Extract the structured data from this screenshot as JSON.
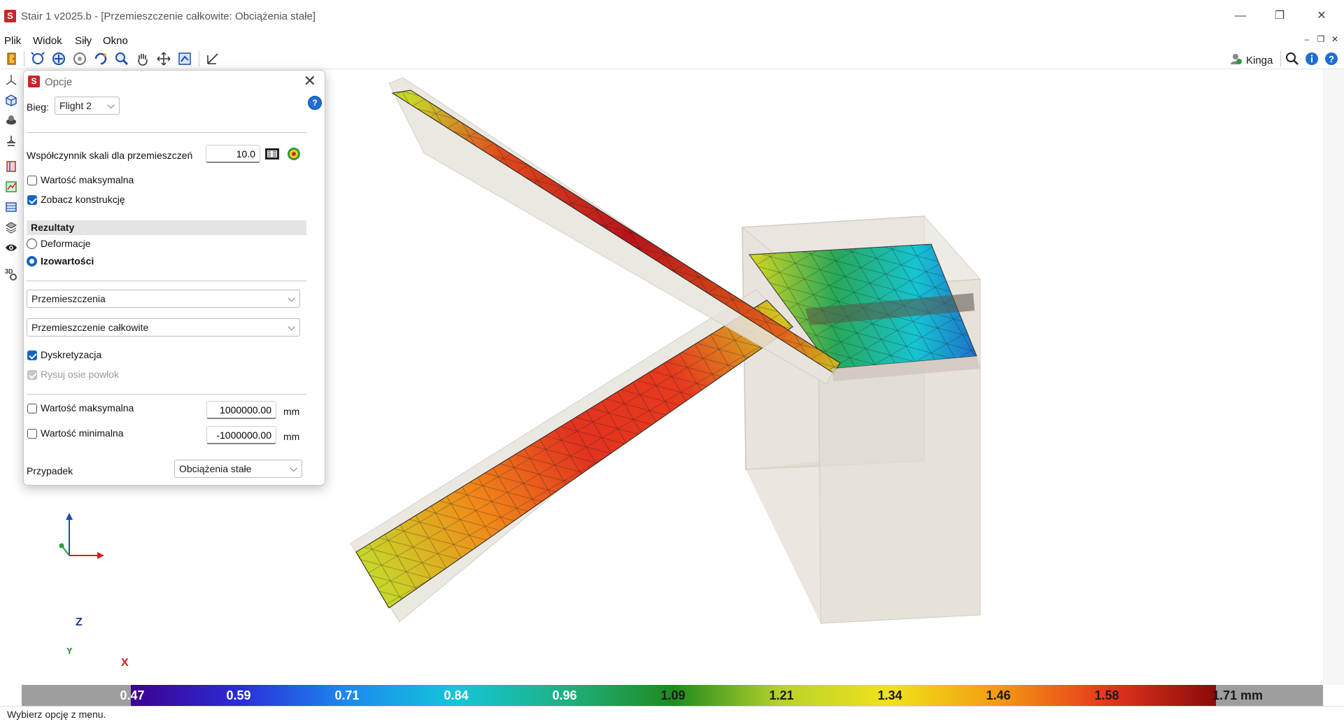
{
  "window": {
    "title": "Stair 1 v2025.b - [Przemieszczenie całkowite: Obciążenia stałe]",
    "app_icon_letter": "S",
    "minimize": "—",
    "restore": "❐",
    "close": "✕"
  },
  "menu": {
    "items": [
      "Plik",
      "Widok",
      "Siły",
      "Okno"
    ]
  },
  "mdi": {
    "minimize": "–",
    "restore": "❐",
    "close": "✕"
  },
  "toolbar": {
    "user_name": "Kinga"
  },
  "panel": {
    "title": "Opcje",
    "icon_letter": "S",
    "close": "✕",
    "help": "?",
    "flight_label": "Bieg:",
    "flight_value": "Flight 2",
    "scale_label": "Współczynnik skali dla przemieszczeń",
    "scale_value": "10.0",
    "max_value_label": "Wartość maksymalna",
    "max_value_checked": false,
    "show_structure_label": "Zobacz konstrukcję",
    "show_structure_checked": true,
    "results_header": "Rezultaty",
    "radio_deformation": "Deformacje",
    "radio_isovalues": "Izowartości",
    "selected_result": "Izowartości",
    "dropdown_quantity": "Przemieszczenia",
    "dropdown_component": "Przemieszczenie całkowite",
    "discretization_label": "Dyskretyzacja",
    "discretization_checked": true,
    "shell_axes_label": "Rysuj osie powłok",
    "shell_axes_checked": true,
    "limit_max_label": "Wartość maksymalna",
    "limit_max_value": "1000000.00",
    "limit_min_label": "Wartość minimalna",
    "limit_min_value": "-1000000.00",
    "unit": "mm",
    "case_label": "Przypadek",
    "case_value": "Obciążenia stałe"
  },
  "axes": {
    "z": "Z",
    "y": "Y",
    "x": "X"
  },
  "colorbar": {
    "labels": [
      "0.47",
      "0.59",
      "0.71",
      "0.84",
      "0.96",
      "1.09",
      "1.21",
      "1.34",
      "1.46",
      "1.58",
      "1.71 mm"
    ],
    "colors": {
      "low": "#3d0090",
      "mid": "#1f8a1f",
      "high": "#8a0a0a"
    }
  },
  "status": {
    "text": "Wybierz opcję z menu."
  },
  "icons": {
    "exit": "door-exit-icon",
    "user": "user-icon",
    "search": "search-icon",
    "info": "info-icon",
    "help": "help-icon"
  }
}
